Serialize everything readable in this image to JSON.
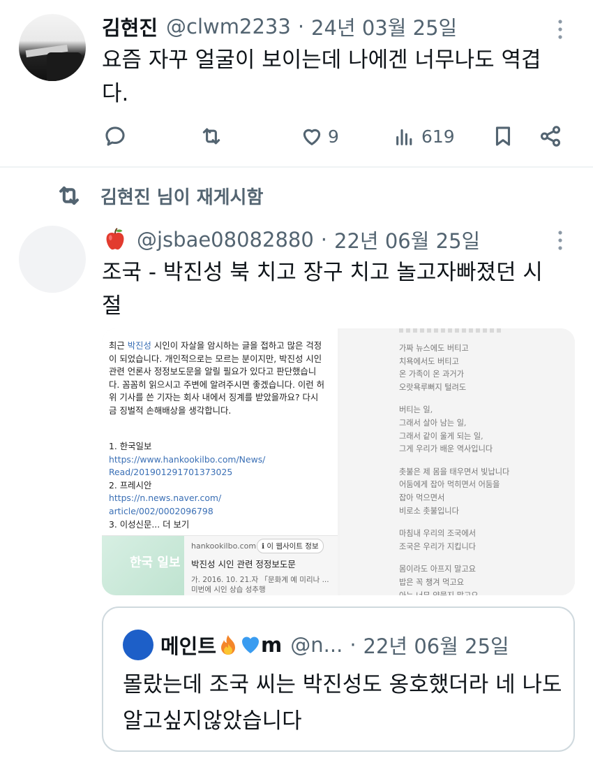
{
  "tweet1": {
    "name": "김현진",
    "handle": "@clwm2233",
    "separator": "·",
    "date": "24년 03월 25일",
    "text": "요즘 자꾸 얼굴이 보이는데 나에겐 너무나도 역겹다.",
    "likes": "9",
    "views": "619"
  },
  "repost_label": "김현진 님이 재게시함",
  "tweet2": {
    "handle": "@jsbae08082880",
    "separator": "·",
    "date": "22년 06월 25일",
    "text": "조국 - 박진성 북 치고 장구 치고 놀고자빠졌던 시절",
    "image_left": {
      "body_pre": "최근 ",
      "body_link": "박진성",
      "body_post": " 시인이 자살을 암시하는 글을 접하고 많은 걱정이 되었습니다. 개인적으로는 모르는 분이지만, 박진성 시인 관련 언론사 정정보도문을 알릴 필요가 있다고 판단했습니다. 꼼꼼히 읽으시고 주변에 알려주시면 좋겠습니다. 이런 허위 기사를 쓴 기자는 회사 내에서 징계를 받았을까요? 다시금 징벌적 손해배상을 생각합니다.",
      "item1": "1. 한국일보",
      "link1a": "https://www.hankookilbo.com/News/",
      "link1b": "Read/201901291701373025",
      "item2": "2. 프레시안",
      "link2a": "https://n.news.naver.com/",
      "link2b": "article/002/0002096798",
      "item3": "3. 이성신문... 더 보기",
      "card_thumb": "한국 일보",
      "card_domain": "hankookilbo.com",
      "card_badge": "ℹ 이 웹사이트 정보",
      "card_title": "박진성 시인 관련 정정보도문",
      "card_snippet": "가. 2016. 10. 21.자 「문화계 예 미리나 ... 미번에 시인 상습 성추행"
    },
    "image_right": {
      "lines1": [
        "가짜 뉴스에도 버티고",
        "치욕에서도 버티고",
        "온 가족이 온 과거가",
        "오랏욕루뻐지 털려도"
      ],
      "lines2": [
        "버티는 일,",
        "그래서 살아 남는 일,",
        "그래서 같이 울게 되는 일,",
        "그게 우리가 배운 역사입니다"
      ],
      "lines3": [
        "촛불은 제 몸을 태우면서 빛납니다",
        "어둠에게 잡아 먹히면서 어둠을",
        "잡아 먹으면서",
        "비로소 촛불입니다"
      ],
      "lines4": [
        "마침내 우리의 조국에서",
        "조국은 우리가 지킵니다"
      ],
      "lines5": [
        "몸이라도 아프지 말고요",
        "밥은 꼭 챙겨 먹고요",
        "아는 너무 약물지 말고요"
      ]
    }
  },
  "quote": {
    "name": "메인트",
    "name_suffix": "m",
    "handle": "@n...",
    "separator": "·",
    "date": "22년 06월 25일",
    "text": "몰랐는데 조국 씨는 박진성도 옹호했더라 네 나도 알고싶지않았습니다"
  },
  "colors": {
    "text": "#0f1419",
    "secondary": "#536471",
    "border": "#cfd9de",
    "quote_avatar": "#1d5fc8"
  },
  "icons": [
    "more-icon",
    "reply-icon",
    "retweet-icon",
    "like-icon",
    "views-icon",
    "bookmark-icon",
    "share-icon",
    "apple-emoji",
    "fire-emoji",
    "blue-heart-emoji"
  ]
}
